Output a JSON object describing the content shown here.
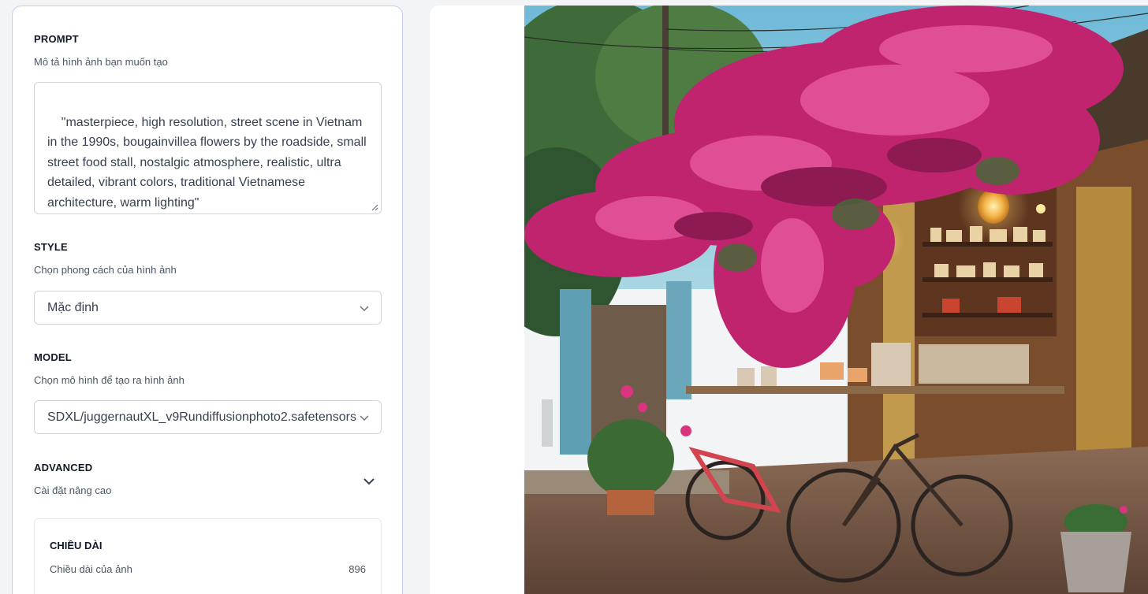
{
  "prompt": {
    "title": "PROMPT",
    "subtitle": "Mô tả hình ảnh bạn muốn tạo",
    "value": "\"masterpiece, high resolution, street scene in Vietnam in the 1990s, bougainvillea flowers by the roadside, small street food stall, nostalgic atmosphere, realistic, ultra detailed, vibrant colors, traditional Vietnamese architecture, warm lighting\""
  },
  "style": {
    "title": "STYLE",
    "subtitle": "Chọn phong cách của hình ảnh",
    "selected": "Mặc định"
  },
  "model": {
    "title": "MODEL",
    "subtitle": "Chọn mô hình để tạo ra hình ảnh",
    "selected": "SDXL/juggernautXL_v9Rundiffusionphoto2.safetensors"
  },
  "advanced": {
    "title": "ADVANCED",
    "subtitle": "Cài đặt nâng cao",
    "length": {
      "title": "CHIỀU DÀI",
      "label": "Chiều dài của ảnh",
      "value": "896"
    }
  },
  "colors": {
    "panel_border": "#c7cbf2",
    "bougainvillea": "#c0246e",
    "sky": "#7cc3df"
  },
  "icons": [
    "chevron-down-icon",
    "resize-handle-icon"
  ]
}
